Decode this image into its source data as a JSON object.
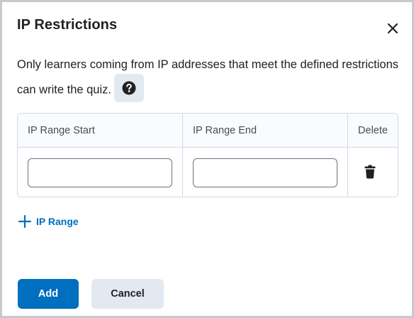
{
  "dialog": {
    "title": "IP Restrictions",
    "close_icon": "close-icon",
    "description": "Only learners coming from IP addresses that meet the defined restrictions can write the quiz.",
    "help_icon": "help-circle-icon"
  },
  "table": {
    "headers": {
      "start": "IP Range Start",
      "end": "IP Range End",
      "delete": "Delete"
    },
    "rows": [
      {
        "start_value": "",
        "end_value": "",
        "delete_icon": "trash-icon"
      }
    ]
  },
  "add_range": {
    "icon": "plus-icon",
    "label": "IP Range"
  },
  "footer": {
    "add_label": "Add",
    "cancel_label": "Cancel"
  },
  "colors": {
    "primary": "#006fbf",
    "secondary_bg": "#e3e9f1",
    "border": "#d3d9e3",
    "text": "#202122"
  }
}
